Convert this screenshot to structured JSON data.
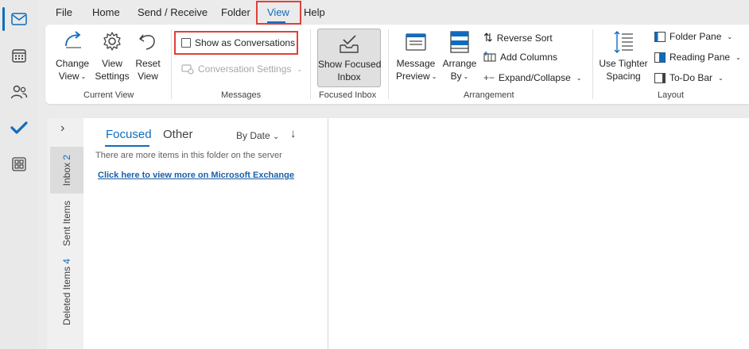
{
  "menu": {
    "items": [
      "File",
      "Home",
      "Send / Receive",
      "Folder",
      "View",
      "Help"
    ],
    "active": "View"
  },
  "ribbon": {
    "current_view": {
      "change_view": [
        "Change",
        "View"
      ],
      "view_settings": [
        "View",
        "Settings"
      ],
      "reset_view": [
        "Reset",
        "View"
      ],
      "group_label": "Current View"
    },
    "messages": {
      "show_as_conversations": "Show as Conversations",
      "show_as_conversations_checked": false,
      "conversation_settings": "Conversation Settings",
      "group_label": "Messages"
    },
    "focused_inbox": {
      "button": [
        "Show Focused",
        "Inbox"
      ],
      "group_label": "Focused Inbox"
    },
    "arrangement": {
      "message_preview": [
        "Message",
        "Preview"
      ],
      "arrange_by": [
        "Arrange",
        "By"
      ],
      "reverse_sort": "Reverse Sort",
      "add_columns": "Add Columns",
      "expand_collapse": "Expand/Collapse",
      "group_label": "Arrangement"
    },
    "layout": {
      "use_tighter_spacing": [
        "Use Tighter",
        "Spacing"
      ],
      "folder_pane": "Folder Pane",
      "reading_pane": "Reading Pane",
      "todo_bar": "To-Do Bar",
      "group_label": "Layout"
    }
  },
  "folder_pane": {
    "expand_glyph": "›",
    "tabs": [
      {
        "label": "Inbox",
        "count": "2"
      },
      {
        "label": "Sent Items",
        "count": ""
      },
      {
        "label": "Deleted Items",
        "count": "4"
      }
    ]
  },
  "message_list": {
    "tab_focused": "Focused",
    "tab_other": "Other",
    "sort_by": "By Date",
    "sort_direction_glyph": "↓",
    "info": "There are more items in this folder on the server",
    "link": "Click here to view more on Microsoft Exchange"
  },
  "colors": {
    "accent": "#0f6cbd",
    "highlight": "#e0403a"
  }
}
